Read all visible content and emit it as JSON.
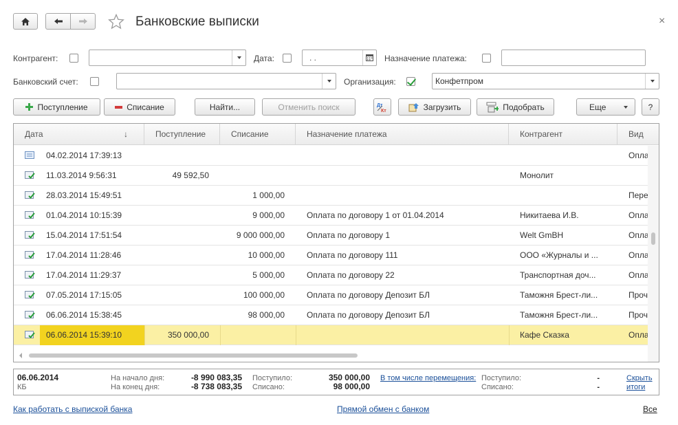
{
  "header": {
    "title": "Банковские выписки",
    "close": "×"
  },
  "filters": {
    "counterparty_label": "Контрагент:",
    "counterparty_value": "",
    "date_label": "Дата:",
    "date_value": ". .",
    "purpose_label": "Назначение платежа:",
    "purpose_value": "",
    "account_label": "Банковский счет:",
    "account_value": "",
    "org_label": "Организация:",
    "org_value": "Конфетпром"
  },
  "toolbar": {
    "receipt": "Поступление",
    "writeoff": "Списание",
    "find": "Найти...",
    "cancel_search": "Отменить поиск",
    "load": "Загрузить",
    "select": "Подобрать",
    "more": "Еще",
    "help": "?"
  },
  "table": {
    "columns": [
      "Дата",
      "Поступление",
      "Списание",
      "Назначение платежа",
      "Контрагент",
      "Вид"
    ],
    "sort_indicator": "↓",
    "rows": [
      {
        "date": "04.02.2014 17:39:13",
        "income": "",
        "expense": "",
        "purpose": "",
        "counterparty": "",
        "kind": "Опла",
        "icon": "doc-plain"
      },
      {
        "date": "11.03.2014 9:56:31",
        "income": "49 592,50",
        "expense": "",
        "purpose": "",
        "counterparty": "Монолит",
        "kind": "",
        "icon": "doc-posted"
      },
      {
        "date": "28.03.2014 15:49:51",
        "income": "",
        "expense": "1 000,00",
        "purpose": "",
        "counterparty": "",
        "kind": "Пере",
        "icon": "doc-posted"
      },
      {
        "date": "01.04.2014 10:15:39",
        "income": "",
        "expense": "9 000,00",
        "purpose": "Оплата по договору 1 от 01.04.2014",
        "counterparty": "Никитаева И.В.",
        "kind": "Опла",
        "icon": "doc-posted"
      },
      {
        "date": "15.04.2014 17:51:54",
        "income": "",
        "expense": "9 000 000,00",
        "purpose": "Оплата по договору 1",
        "counterparty": "Welt GmBH",
        "kind": "Опла",
        "icon": "doc-posted"
      },
      {
        "date": "17.04.2014 11:28:46",
        "income": "",
        "expense": "10 000,00",
        "purpose": "Оплата по договору 111",
        "counterparty": "ООО «Журналы и ...",
        "kind": "Опла",
        "icon": "doc-posted"
      },
      {
        "date": "17.04.2014 11:29:37",
        "income": "",
        "expense": "5 000,00",
        "purpose": "Оплата по договору 22",
        "counterparty": "Транспортная доч...",
        "kind": "Опла",
        "icon": "doc-posted"
      },
      {
        "date": "07.05.2014 17:15:05",
        "income": "",
        "expense": "100 000,00",
        "purpose": "Оплата по договору Депозит БЛ",
        "counterparty": "Таможня Брест-ли...",
        "kind": "Проч",
        "icon": "doc-posted"
      },
      {
        "date": "06.06.2014 15:38:45",
        "income": "",
        "expense": "98 000,00",
        "purpose": "Оплата по договору Депозит БЛ",
        "counterparty": "Таможня Брест-ли...",
        "kind": "Проч",
        "icon": "doc-posted"
      },
      {
        "date": "06.06.2014 15:39:10",
        "income": "350 000,00",
        "expense": "",
        "purpose": "",
        "counterparty": "Кафе Сказка",
        "kind": "Опла",
        "icon": "doc-posted",
        "selected": true
      }
    ]
  },
  "summary": {
    "date": "06.06.2014",
    "account_short": "КБ",
    "start_label": "На начало дня:",
    "start_value": "-8 990 083,35",
    "end_label": "На конец дня:",
    "end_value": "-8 738 083,35",
    "received_label": "Поступило:",
    "received_value": "350 000,00",
    "spent_label": "Списано:",
    "spent_value": "98 000,00",
    "transfers_link": "В том числе перемещения:",
    "t_received_label": "Поступило:",
    "t_received_value": "-",
    "t_spent_label": "Списано:",
    "t_spent_value": "-",
    "hide_link_1": "Скрыть",
    "hide_link_2": "итоги"
  },
  "links": {
    "how_to": "Как работать с выпиской банка",
    "direct_exchange": "Прямой обмен с банком",
    "all": "Все"
  },
  "colors": {
    "selected_row": "#fbf0a4",
    "selected_date": "#f2d31f",
    "link": "#1a4f99",
    "check_green": "#2a9d3a"
  }
}
